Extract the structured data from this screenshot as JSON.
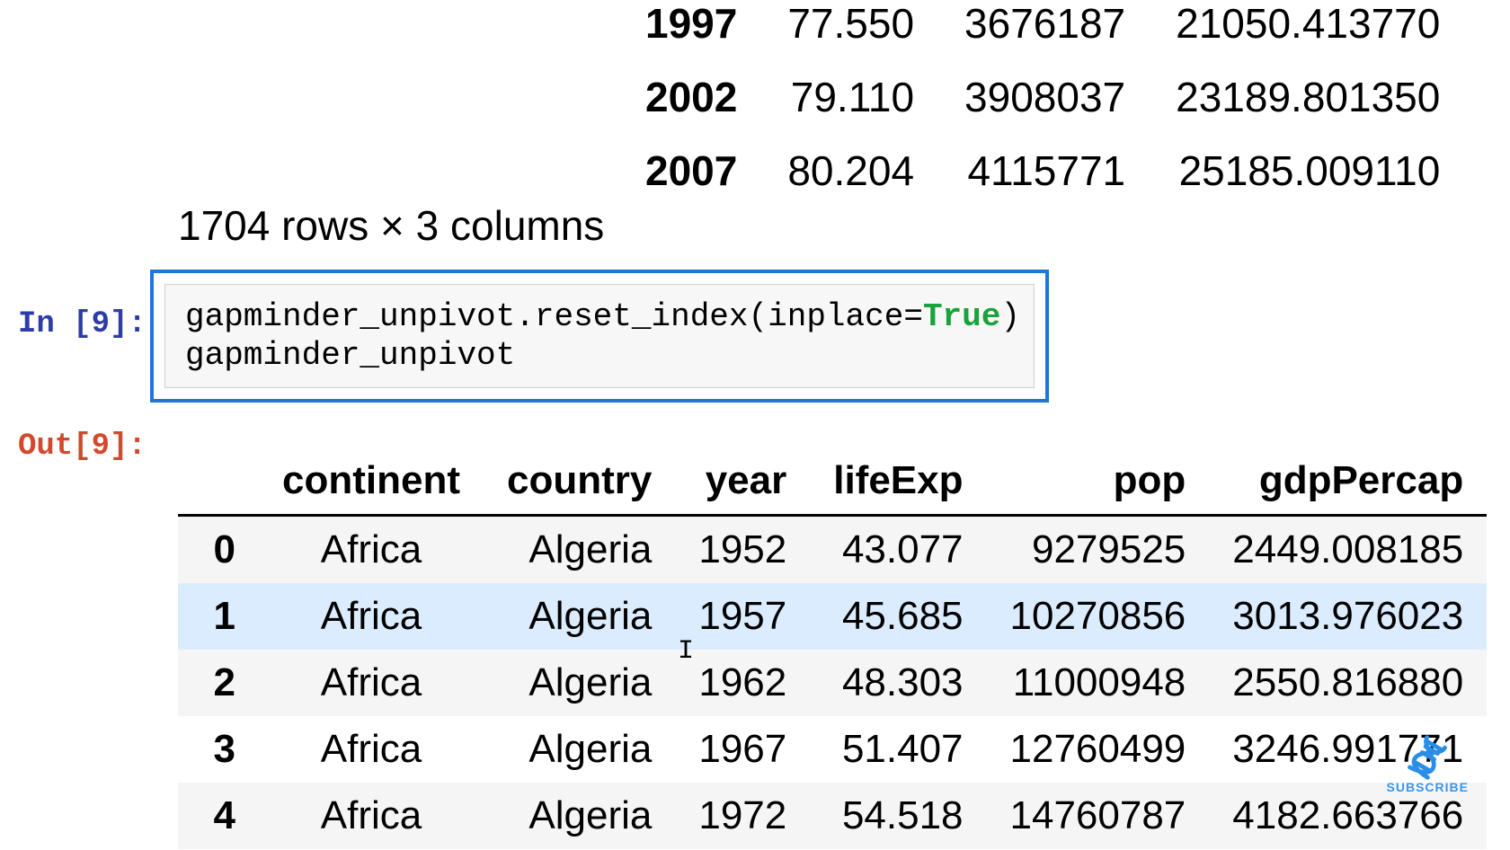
{
  "top_partial": {
    "rows": [
      {
        "year": "1997",
        "lifeExp": "77.550",
        "pop": "3676187",
        "gdp": "21050.413770"
      },
      {
        "year": "2002",
        "lifeExp": "79.110",
        "pop": "3908037",
        "gdp": "23189.801350"
      },
      {
        "year": "2007",
        "lifeExp": "80.204",
        "pop": "4115771",
        "gdp": "25185.009110"
      }
    ]
  },
  "table_summary": "1704 rows × 3 columns",
  "input_prompt": "In [9]:",
  "code": {
    "line1_pre": "gapminder_unpivot.reset_index(inplace=",
    "line1_kw": "True",
    "line1_post": ")",
    "line2": "gapminder_unpivot"
  },
  "output_prompt": "Out[9]:",
  "out_table": {
    "headers": {
      "idx": "",
      "continent": "continent",
      "country": "country",
      "year": "year",
      "lifeExp": "lifeExp",
      "pop": "pop",
      "gdpPercap": "gdpPercap"
    },
    "rows": [
      {
        "idx": "0",
        "continent": "Africa",
        "country": "Algeria",
        "year": "1952",
        "lifeExp": "43.077",
        "pop": "9279525",
        "gdpPercap": "2449.008185"
      },
      {
        "idx": "1",
        "continent": "Africa",
        "country": "Algeria",
        "year": "1957",
        "lifeExp": "45.685",
        "pop": "10270856",
        "gdpPercap": "3013.976023"
      },
      {
        "idx": "2",
        "continent": "Africa",
        "country": "Algeria",
        "year": "1962",
        "lifeExp": "48.303",
        "pop": "11000948",
        "gdpPercap": "2550.816880"
      },
      {
        "idx": "3",
        "continent": "Africa",
        "country": "Algeria",
        "year": "1967",
        "lifeExp": "51.407",
        "pop": "12760499",
        "gdpPercap": "3246.991771"
      },
      {
        "idx": "4",
        "continent": "Africa",
        "country": "Algeria",
        "year": "1972",
        "lifeExp": "54.518",
        "pop": "14760787",
        "gdpPercap": "4182.663766"
      }
    ]
  },
  "subscribe_label": "SUBSCRIBE"
}
